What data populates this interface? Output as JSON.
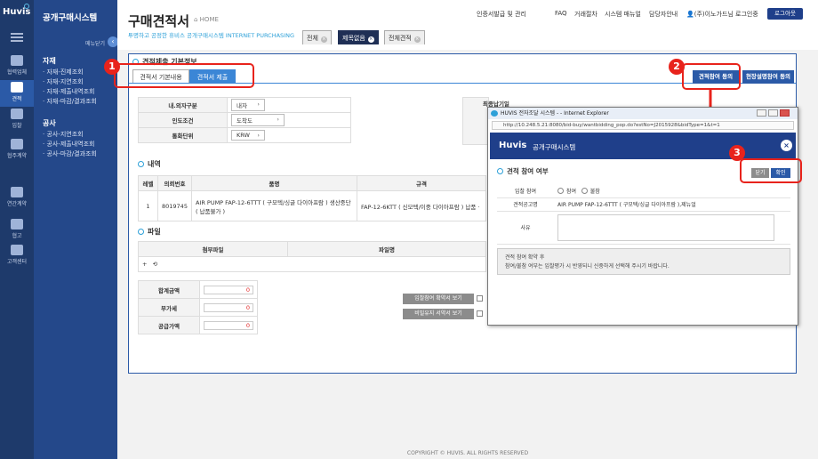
{
  "rail": {
    "logo": "Huvis",
    "items": [
      {
        "label": "협력업체"
      },
      {
        "label": "견적"
      },
      {
        "label": "입찰"
      },
      {
        "label": "협주계약"
      },
      {
        "label": "연간계약"
      },
      {
        "label": "협고"
      },
      {
        "label": "고객센터"
      }
    ]
  },
  "sidebar": {
    "title": "공개구매시스템",
    "collapse_label": "메뉴닫기",
    "groups": [
      {
        "title": "자재",
        "items": [
          "· 자재-진제조회",
          "· 자재-지연조회",
          "· 자재-제출내역조회",
          "· 자재-마감/결과조회"
        ]
      },
      {
        "title": "공사",
        "items": [
          "· 공사-지연조회",
          "· 공사-제출내역조회",
          "· 공사-마감/결과조회"
        ]
      }
    ]
  },
  "header": {
    "title": "구매견적서",
    "home": "HOME",
    "subtitle": "투명하고 공정한 휴비스 공개구매시스템  INTERNET PURCHASING",
    "nav": [
      "인증서발급 및 관리",
      "FAQ",
      "거래절차",
      "시스템 매뉴얼",
      "담당자안내"
    ],
    "user": "(주)이노가드님 로그인중",
    "logout": "로그아웃",
    "tabs": [
      "전체",
      "제목없음",
      "전체견적"
    ]
  },
  "content": {
    "section_title": "견적제출 기본정보",
    "tabs": [
      "견적서 기본내용",
      "견적서 제출"
    ],
    "basic_rows": [
      {
        "label": "내.외자구분",
        "value": "내자"
      },
      {
        "label": "인도조건",
        "value": "도착도"
      },
      {
        "label": "통화단위",
        "value": "KRW"
      }
    ],
    "right_label": "최종납기일",
    "items_title": "내역",
    "items_headers": [
      "레벨",
      "의뢰번호",
      "품명",
      "규격"
    ],
    "items_rows": [
      {
        "level": "1",
        "no": "8019745",
        "name": "AIR PUMP FAP-12-6TTT ( 구모텍/싱글 다이아프람 ) 생산중단( 납품불가 )",
        "spec": "FAP-12-6KTT ( 신모텍/이중 다이아프람 ) 납품 ·"
      }
    ],
    "files_title": "파일",
    "files_headers": [
      "첨부파일",
      "파일명"
    ],
    "file_tools": [
      "+",
      "⟲"
    ],
    "totals": [
      {
        "label": "합계금액",
        "value": "0"
      },
      {
        "label": "부가세",
        "value": "0"
      },
      {
        "label": "공급가액",
        "value": "0"
      }
    ],
    "gray_buttons": [
      "입찰참여 확약서 보기",
      "비밀유지 서약서 보기"
    ],
    "blue_buttons": [
      "견적참여 동의",
      "현장설명참여 동의"
    ]
  },
  "callouts": [
    "1",
    "2",
    "3"
  ],
  "popup": {
    "window_title": "HUVIS 전자조달 시스템 - - Internet Explorer",
    "url": "http://10.248.5.21:8080/bid-buy/wantbidding_pop.do?estNo=J2015928&bidType=1&t=1",
    "brand": "Huvis",
    "name": "공개구매시스템",
    "section_title": "견적 참여 여부",
    "close_btn": "닫기",
    "confirm_btn": "확인",
    "rows": [
      {
        "label": "입찰 참여",
        "opt1": "참여",
        "opt2": "불참"
      },
      {
        "label": "견적공고명",
        "value": "AIR PUMP FAP-12-6TTT ( 구모텍/싱글 다이아프람 ),제뉴얼"
      },
      {
        "label": "사유"
      }
    ],
    "notice_title": "견적 참여 확약 후",
    "notice_body": "참여/불참 여부는 입찰평가 시 반영되니 신중하게 선택해 주시기 바랍니다."
  },
  "footer": "COPYRIGHT © HUVIS. ALL RIGHTS RESERVED",
  "colors": {
    "navy": "#1e3a6b",
    "accent": "#2da0d8",
    "callout": "#e8231c"
  }
}
